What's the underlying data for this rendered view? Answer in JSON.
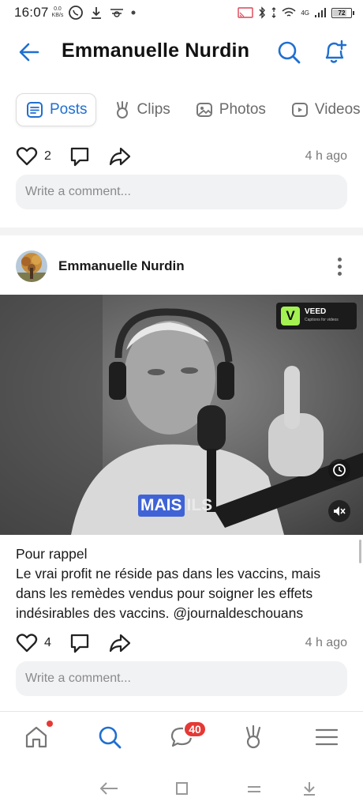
{
  "status_bar": {
    "time": "16:07",
    "speed_value": "0.0",
    "speed_unit": "KB/s",
    "signal_label": "4G",
    "battery_level": "72"
  },
  "header": {
    "title": "Emmanuelle Nurdin",
    "back_icon": "arrow-left-icon",
    "search_icon": "search-icon",
    "notification_icon": "bell-plus-icon",
    "accent_color": "#1f6fd1"
  },
  "tabs": [
    {
      "label": "Posts",
      "icon": "posts-icon",
      "active": true
    },
    {
      "label": "Clips",
      "icon": "clips-icon",
      "active": false
    },
    {
      "label": "Photos",
      "icon": "photos-icon",
      "active": false
    },
    {
      "label": "Videos",
      "icon": "videos-icon",
      "active": false
    }
  ],
  "previous_post": {
    "likes": "2",
    "time_ago": "4 h ago",
    "comment_placeholder": "Write a comment..."
  },
  "post": {
    "author": "Emmanuelle Nurdin",
    "video": {
      "watermark_name": "VEED",
      "watermark_sub": "Captions for videos",
      "caption_highlight": "MAIS",
      "caption_rest": "ILS"
    },
    "text_line1": "Pour rappel",
    "text_line2": "Le vrai profit ne réside pas dans les vaccins, mais dans les remèdes vendus pour soigner les effets indésirables des vaccins. @journaldeschouans",
    "likes": "4",
    "time_ago": "4 h ago",
    "comment_placeholder": "Write a comment..."
  },
  "bottom_nav": {
    "items": [
      "home-icon",
      "search-icon",
      "messages-icon",
      "clips-icon",
      "menu-icon"
    ],
    "messages_badge": "40"
  },
  "system_nav": [
    "back-icon",
    "home-square-icon",
    "recents-icon",
    "notification-pull-icon"
  ]
}
